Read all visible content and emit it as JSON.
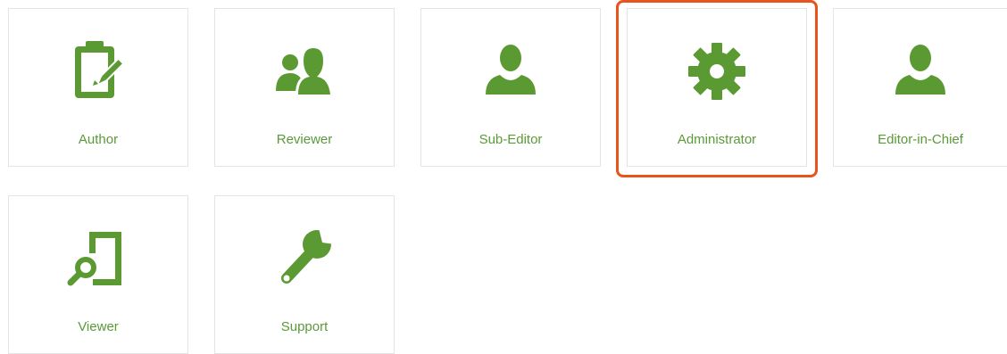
{
  "colors": {
    "icon_green": "#5b9a32",
    "label_green": "#5a9a38",
    "tile_border": "#e4e4e4",
    "highlight_border": "#e8541c"
  },
  "roles": [
    {
      "label": "Author",
      "icon": "clipboard-pencil-icon"
    },
    {
      "label": "Reviewer",
      "icon": "two-users-icon"
    },
    {
      "label": "Sub-Editor",
      "icon": "user-icon"
    },
    {
      "label": "Administrator",
      "icon": "gear-icon",
      "highlighted": true
    },
    {
      "label": "Editor-in-Chief",
      "icon": "user-icon"
    },
    {
      "label": "Viewer",
      "icon": "document-magnifier-icon"
    },
    {
      "label": "Support",
      "icon": "wrench-icon"
    }
  ]
}
